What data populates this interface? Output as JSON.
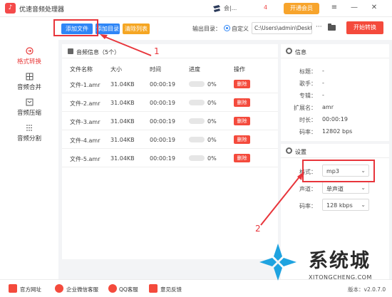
{
  "app": {
    "title": "优速音频处理器",
    "logo_text": "♪",
    "user_name": "会|...",
    "level": "4",
    "vip_button": "开通会员"
  },
  "toolbar": {
    "add_file": "添加文件",
    "add_dir": "添加目录",
    "clear_list": "清除列表",
    "output_label": "输出目录：",
    "radio_label": "自定义",
    "output_path": "C:\\Users\\admin\\Deskto",
    "more": "···",
    "start": "开始转换"
  },
  "sidebar": {
    "items": [
      {
        "label": "格式转换",
        "icon": "format-convert-icon",
        "active": true
      },
      {
        "label": "音频合并",
        "icon": "audio-merge-icon",
        "active": false
      },
      {
        "label": "音频压缩",
        "icon": "audio-compress-icon",
        "active": false
      },
      {
        "label": "音频分割",
        "icon": "audio-split-icon",
        "active": false
      }
    ]
  },
  "files": {
    "header": "音频信息（5个）",
    "columns": [
      "文件名称",
      "大小",
      "时间",
      "进度",
      "操作"
    ],
    "rows": [
      {
        "name": "文件-1.amr",
        "size": "31.04KB",
        "time": "00:00:19",
        "progress": "0%",
        "progress_value": 0,
        "action": "删除"
      },
      {
        "name": "文件-2.amr",
        "size": "31.04KB",
        "time": "00:00:19",
        "progress": "0%",
        "progress_value": 0,
        "action": "删除"
      },
      {
        "name": "文件-3.amr",
        "size": "31.04KB",
        "time": "00:00:19",
        "progress": "0%",
        "progress_value": 0,
        "action": "删除"
      },
      {
        "name": "文件-4.amr",
        "size": "31.04KB",
        "time": "00:00:19",
        "progress": "0%",
        "progress_value": 0,
        "action": "删除"
      },
      {
        "name": "文件-5.amr",
        "size": "31.04KB",
        "time": "00:00:19",
        "progress": "0%",
        "progress_value": 0,
        "action": "删除"
      }
    ]
  },
  "info": {
    "title": "信息",
    "fields": [
      {
        "key": "标题：",
        "value": "-"
      },
      {
        "key": "歌手：",
        "value": "-"
      },
      {
        "key": "专辑：",
        "value": "-"
      },
      {
        "key": "扩展名：",
        "value": "amr"
      },
      {
        "key": "时长：",
        "value": "00:00:19"
      },
      {
        "key": "码率：",
        "value": "12802 bps"
      }
    ]
  },
  "settings": {
    "title": "设置",
    "format_label": "格式：",
    "format_value": "mp3",
    "channel_label": "声道：",
    "channel_value": "单声道",
    "bitrate_label": "码率：",
    "bitrate_value": "128 kbps"
  },
  "annotations": {
    "num1": "1",
    "num2": "2",
    "color": "#e8353b"
  },
  "footer": {
    "website": "官方网址",
    "wechat": "企业微信客服",
    "qq": "QQ客服",
    "feedback": "意见反馈",
    "version": "版本：v2.0.7.0"
  },
  "watermark": {
    "text": "系统城",
    "sub": "XITONGCHENG.COM"
  },
  "colors": {
    "accent_blue": "#2f86f6",
    "accent_red": "#f44a3c",
    "accent_orange": "#f5a623"
  }
}
